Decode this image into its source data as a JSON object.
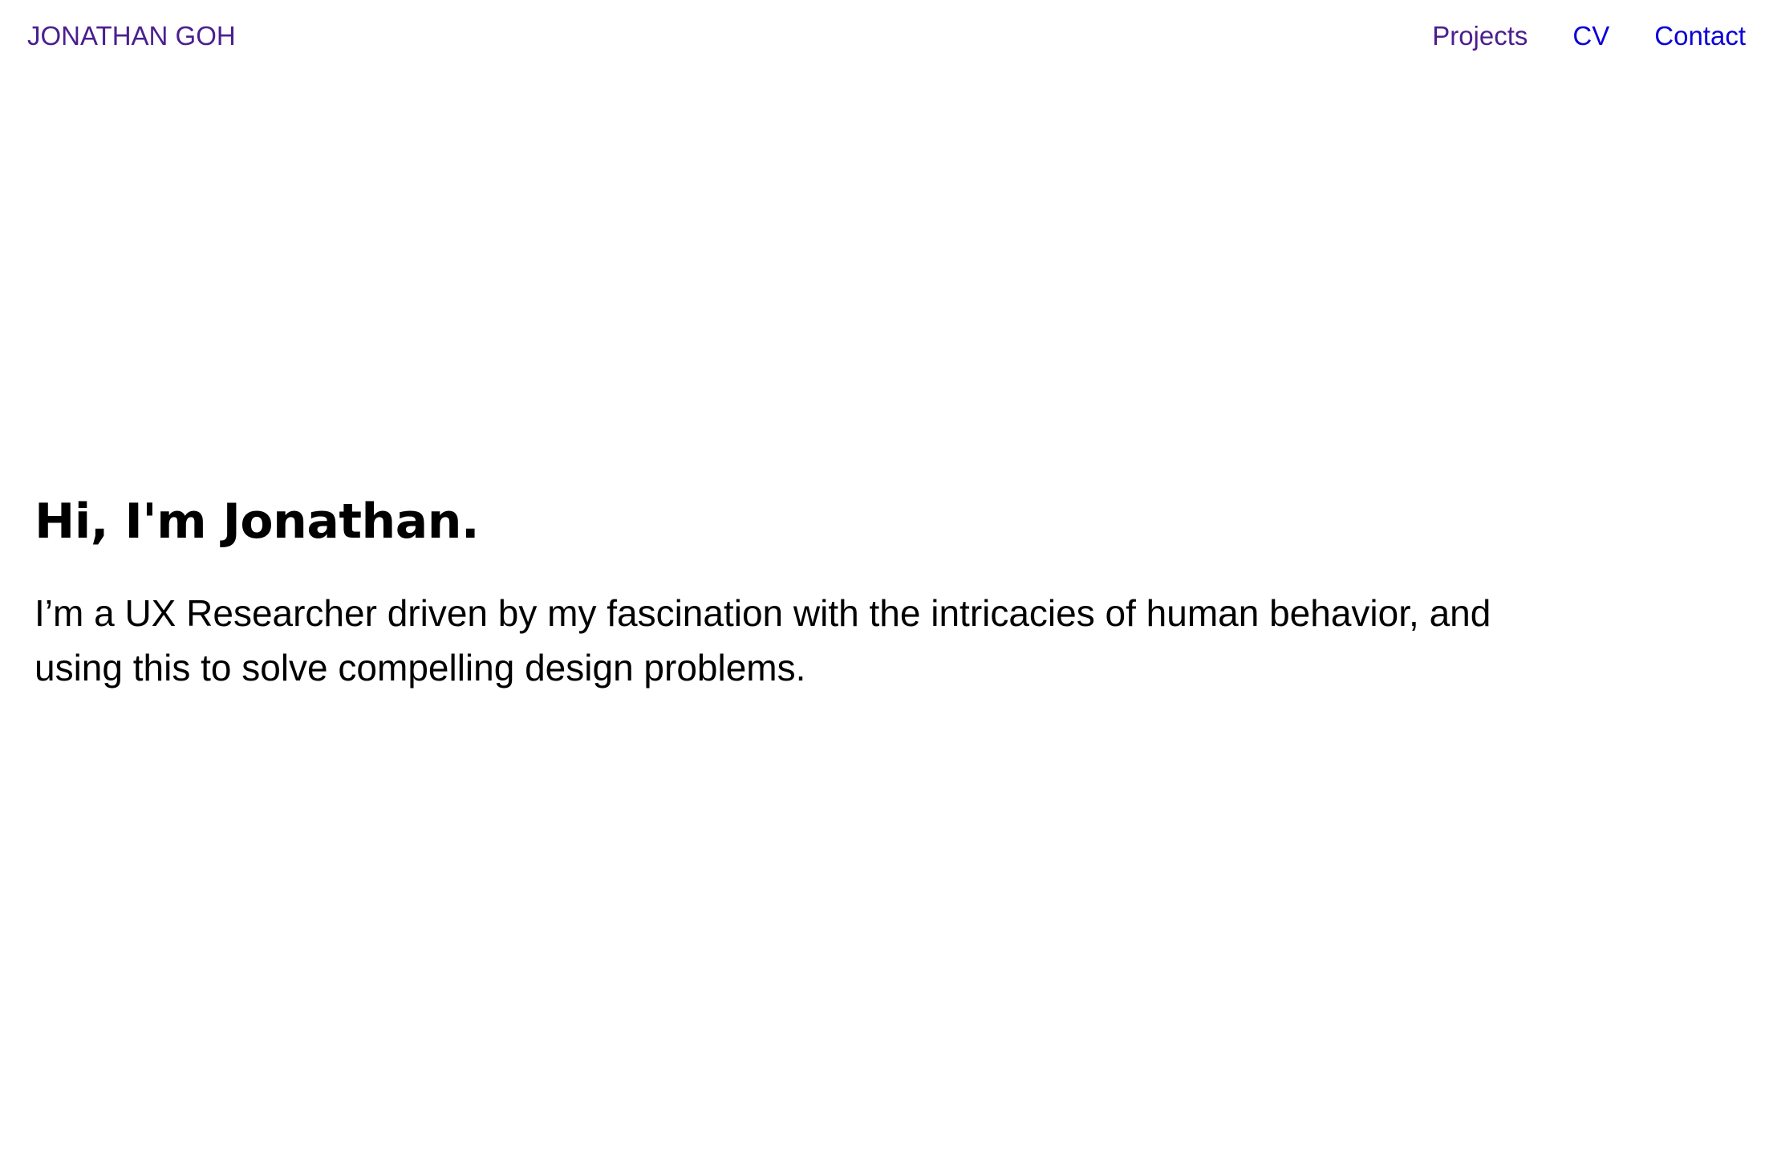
{
  "header": {
    "brand": "JONATHAN GOH",
    "nav": [
      {
        "label": "Projects"
      },
      {
        "label": "CV"
      },
      {
        "label": "Contact"
      }
    ]
  },
  "hero": {
    "title": "Hi, I'm Jonathan.",
    "intro": "I’m a UX Researcher driven by my fascination with the intricacies of human behavior, and using this to solve compelling design problems."
  },
  "colors": {
    "brand": "#4b1f8f",
    "link": "#0b00d9",
    "text": "#000000",
    "background": "#ffffff"
  }
}
